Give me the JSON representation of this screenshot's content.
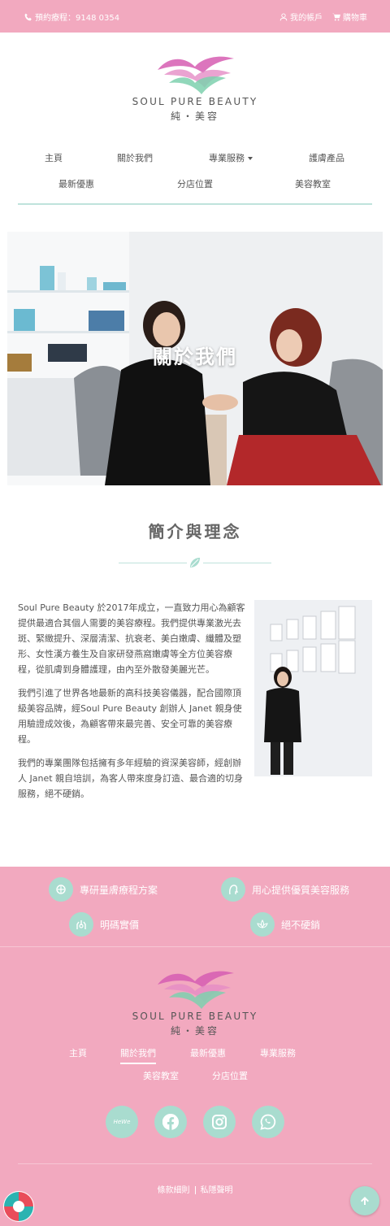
{
  "topbar": {
    "phone_label": "預約療程：9148 0354",
    "account_label": "我的帳戶",
    "cart_label": "購物車"
  },
  "brand": {
    "name_en": "SOUL PURE BEAUTY",
    "name_zh": "純・美容"
  },
  "nav": {
    "items": [
      "主頁",
      "關於我們",
      "專業服務",
      "護膚產品",
      "最新優惠",
      "分店位置",
      "美容教室"
    ]
  },
  "hero": {
    "title": "關於我們"
  },
  "intro": {
    "heading": "簡介與理念",
    "paragraphs": [
      "Soul Pure Beauty 於2017年成立，一直致力用心為顧客提供最適合其個人需要的美容療程。我們提供專業激光去斑、緊緻提升、深層清潔、抗衰老、美白嫩膚、纖體及塑形、女性漢方養生及自家研發燕窩嫩膚等全方位美容療程，從肌膚到身體護理，由內至外散發美麗光芒。",
      "我們引進了世界各地最新的高科技美容儀器，配合國際頂級美容品牌，經Soul Pure Beauty 創辦人 Janet 親身使用驗證成效後，為顧客帶來最完善、安全可靠的美容療程。",
      "我們的專業團隊包括擁有多年經驗的資深美容師，經創辦人 Janet 親自培訓，為客人帶來度身訂造、最合適的切身服務，絕不硬銷。"
    ]
  },
  "features": {
    "items": [
      "專研量膚療程方案",
      "用心提供優質美容服務",
      "明碼實價",
      "絕不硬銷"
    ]
  },
  "footer": {
    "nav": [
      "主頁",
      "關於我們",
      "最新優惠",
      "專業服務",
      "美容教室",
      "分店位置"
    ],
    "social": [
      "hewe-icon",
      "facebook-icon",
      "instagram-icon",
      "whatsapp-icon"
    ],
    "hewe_label": "HeWe",
    "terms_label": "條款細則",
    "privacy_label": "私隱聲明"
  },
  "colors": {
    "pink": "#f2a9bf",
    "mint": "#a9dccf"
  }
}
